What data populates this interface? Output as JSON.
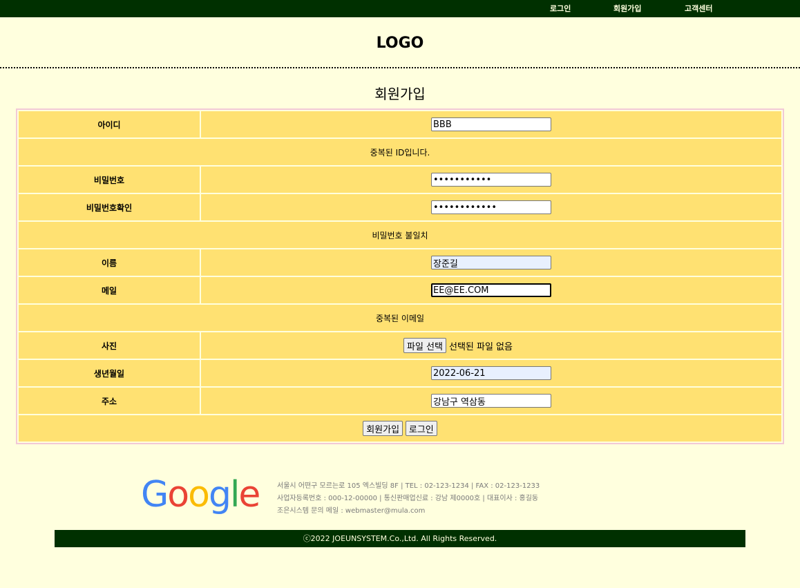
{
  "nav": {
    "login": "로그인",
    "signup": "회원가입",
    "support": "고객센터"
  },
  "header": {
    "logo": "LOGO"
  },
  "page_title": "회원가입",
  "form": {
    "id_label": "아이디",
    "id_value": "BBB",
    "id_message": "중복된 ID입니다.",
    "password_label": "비밀번호",
    "password_value": "•••••••••••",
    "password_confirm_label": "비밀번호확인",
    "password_confirm_value": "••••••••••••",
    "password_message": "비밀번호 불일치",
    "name_label": "이름",
    "name_value": "장준길",
    "email_label": "메일",
    "email_value": "EE@EE.COM",
    "email_message": "중복된 이메일",
    "photo_label": "사진",
    "photo_button": "파일 선택",
    "photo_status": "선택된 파일 없음",
    "birth_label": "생년월일",
    "birth_value": "2022-06-21",
    "address_label": "주소",
    "address_value": "강남구 역삼동",
    "submit_label": "회원가입",
    "login_label": "로그인"
  },
  "footer": {
    "logo_text": "Google",
    "logo_colors": [
      "#4285F4",
      "#EA4335",
      "#FBBC05",
      "#4285F4",
      "#34A853",
      "#EA4335"
    ],
    "info_line1": "서울시 어떤구 모르는로 105 엑스빌딩 8F | TEL : 02-123-1234 | FAX : 02-123-1233",
    "info_line2": "사업자등록번호 : 000-12-00000 | 통신판매업신료 : 강남 제0000호 | 대표이사 : 홍길동",
    "info_line3": "조은시스템 문의 메일 : webmaster@mula.com",
    "copyright": "ⓒ2022 JOEUNSYSTEM.Co.,Ltd. All Rights Reserved."
  },
  "colors": {
    "background": "#ffffde",
    "topbar": "#003000",
    "table_cell": "#ffe172",
    "table_border": "#f2c9d6"
  }
}
